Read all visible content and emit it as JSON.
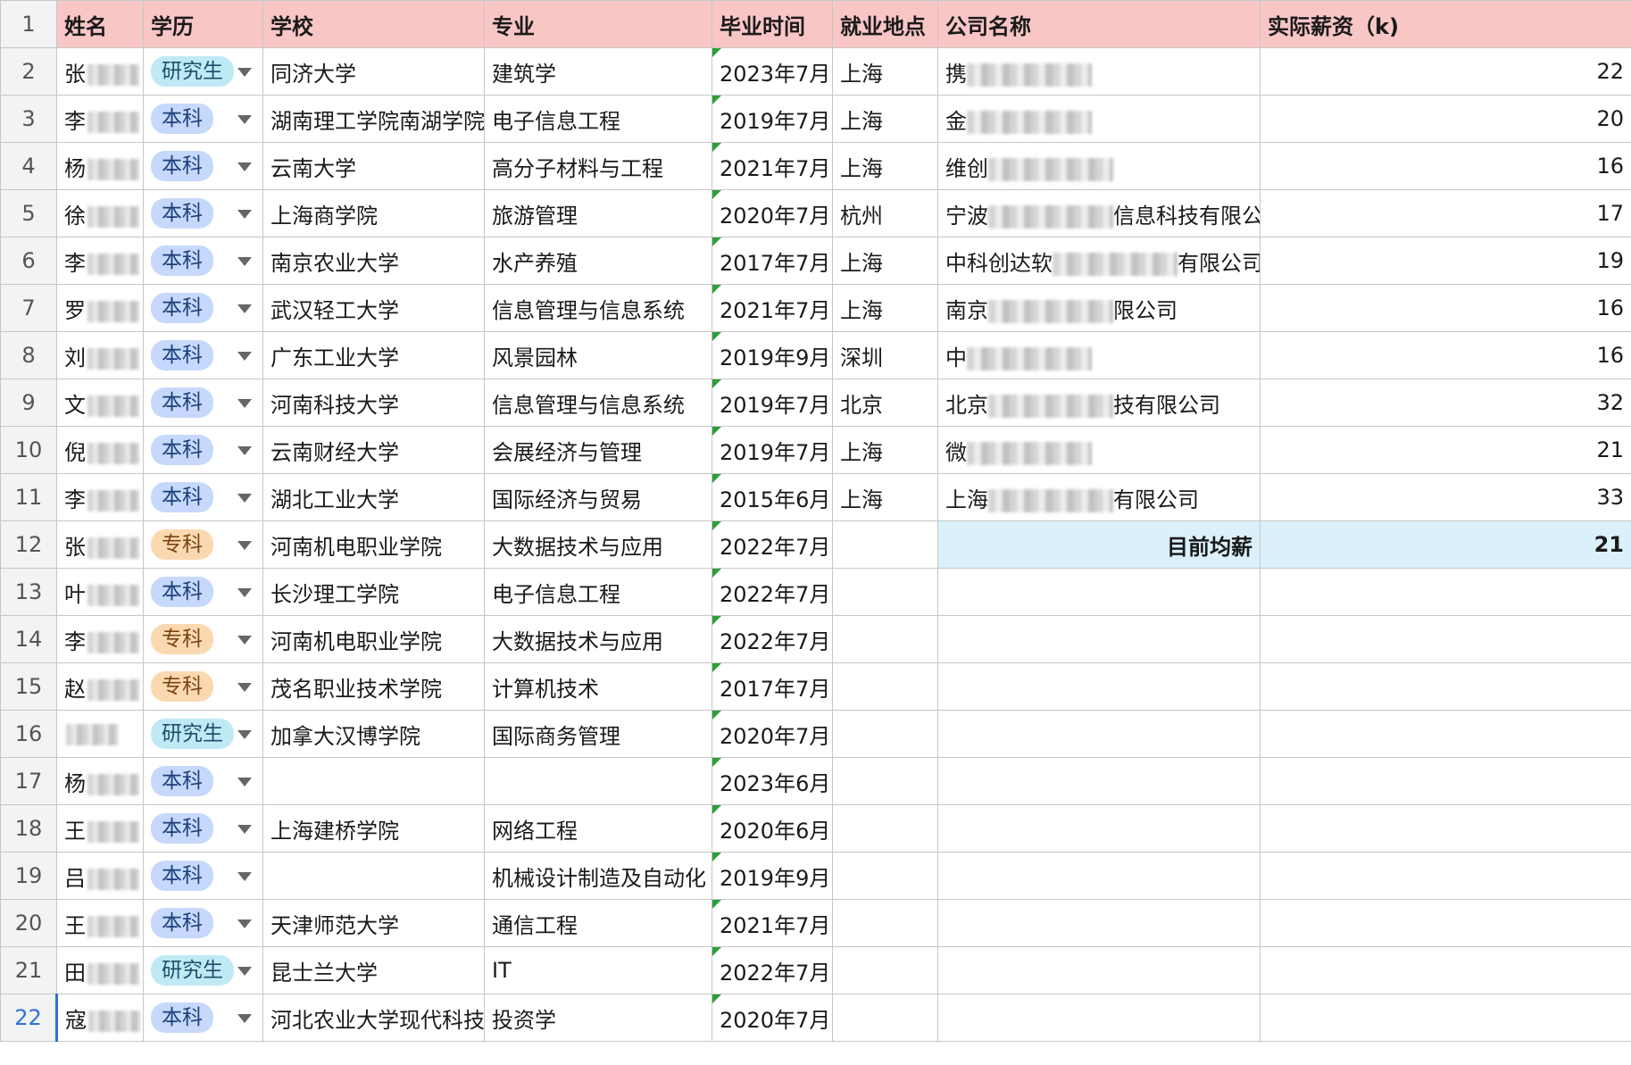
{
  "columns": [
    "姓名",
    "学历",
    "学校",
    "专业",
    "毕业时间",
    "就业地点",
    "公司名称",
    "实际薪资（k)"
  ],
  "header_row_number": "1",
  "rows": [
    {
      "num": "2",
      "name": "张",
      "edu": "研究生",
      "edu_type": "grad",
      "school": "同济大学",
      "major": "建筑学",
      "grad": "2023年7月",
      "loc": "上海",
      "company": "携",
      "salary": "22"
    },
    {
      "num": "3",
      "name": "李",
      "edu": "本科",
      "edu_type": "bach",
      "school": "湖南理工学院南湖学院",
      "major": "电子信息工程",
      "grad": "2019年7月",
      "loc": "上海",
      "company": "金",
      "salary": "20"
    },
    {
      "num": "4",
      "name": "杨",
      "edu": "本科",
      "edu_type": "bach",
      "school": "云南大学",
      "major": "高分子材料与工程",
      "grad": "2021年7月",
      "loc": "上海",
      "company": "维创",
      "salary": "16"
    },
    {
      "num": "5",
      "name": "徐",
      "edu": "本科",
      "edu_type": "bach",
      "school": "上海商学院",
      "major": "旅游管理",
      "grad": "2020年7月",
      "loc": "杭州",
      "company": "宁波",
      "company_suffix": "信息科技有限公司",
      "salary": "17"
    },
    {
      "num": "6",
      "name": "李",
      "edu": "本科",
      "edu_type": "bach",
      "school": "南京农业大学",
      "major": "水产养殖",
      "grad": "2017年7月",
      "loc": "上海",
      "company": "中科创达软",
      "company_suffix": "有限公司",
      "salary": "19"
    },
    {
      "num": "7",
      "name": "罗",
      "edu": "本科",
      "edu_type": "bach",
      "school": "武汉轻工大学",
      "major": "信息管理与信息系统",
      "grad": "2021年7月",
      "loc": "上海",
      "company": "南京",
      "company_suffix": "限公司",
      "salary": "16"
    },
    {
      "num": "8",
      "name": "刘",
      "edu": "本科",
      "edu_type": "bach",
      "school": "广东工业大学",
      "major": "风景园林",
      "grad": "2019年9月",
      "loc": "深圳",
      "company": "中",
      "salary": "16"
    },
    {
      "num": "9",
      "name": "文",
      "edu": "本科",
      "edu_type": "bach",
      "school": "河南科技大学",
      "major": "信息管理与信息系统",
      "grad": "2019年7月",
      "loc": "北京",
      "company": "北京",
      "company_suffix": "技有限公司",
      "salary": "32"
    },
    {
      "num": "10",
      "name": "倪",
      "edu": "本科",
      "edu_type": "bach",
      "school": "云南财经大学",
      "major": "会展经济与管理",
      "grad": "2019年7月",
      "loc": "上海",
      "company": "微",
      "salary": "21"
    },
    {
      "num": "11",
      "name": "李",
      "edu": "本科",
      "edu_type": "bach",
      "school": "湖北工业大学",
      "major": "国际经济与贸易",
      "grad": "2015年6月",
      "loc": "上海",
      "company": "上海",
      "company_suffix": "有限公司",
      "salary": "33"
    },
    {
      "num": "12",
      "name": "张",
      "edu": "专科",
      "edu_type": "assoc",
      "school": "河南机电职业学院",
      "major": "大数据技术与应用",
      "grad": "2022年7月",
      "loc": "",
      "company": "",
      "salary": ""
    },
    {
      "num": "13",
      "name": "叶",
      "edu": "本科",
      "edu_type": "bach",
      "school": "长沙理工学院",
      "major": "电子信息工程",
      "grad": "2022年7月",
      "loc": "",
      "company": "",
      "salary": ""
    },
    {
      "num": "14",
      "name": "李",
      "edu": "专科",
      "edu_type": "assoc",
      "school": "河南机电职业学院",
      "major": "大数据技术与应用",
      "grad": "2022年7月",
      "loc": "",
      "company": "",
      "salary": ""
    },
    {
      "num": "15",
      "name": "赵",
      "edu": "专科",
      "edu_type": "assoc",
      "school": "茂名职业技术学院",
      "major": "计算机技术",
      "grad": "2017年7月",
      "loc": "",
      "company": "",
      "salary": ""
    },
    {
      "num": "16",
      "name": "",
      "edu": "研究生",
      "edu_type": "grad",
      "school": "加拿大汉博学院",
      "major": "国际商务管理",
      "grad": "2020年7月",
      "loc": "",
      "company": "",
      "salary": ""
    },
    {
      "num": "17",
      "name": "杨",
      "edu": "本科",
      "edu_type": "bach",
      "school": "",
      "major": "",
      "grad": "2023年6月",
      "loc": "",
      "company": "",
      "salary": ""
    },
    {
      "num": "18",
      "name": "王",
      "edu": "本科",
      "edu_type": "bach",
      "school": "上海建桥学院",
      "major": "网络工程",
      "grad": "2020年6月",
      "loc": "",
      "company": "",
      "salary": ""
    },
    {
      "num": "19",
      "name": "吕",
      "edu": "本科",
      "edu_type": "bach",
      "school": "",
      "major": "机械设计制造及自动化",
      "grad": "2019年9月",
      "loc": "",
      "company": "",
      "salary": ""
    },
    {
      "num": "20",
      "name": "王",
      "edu": "本科",
      "edu_type": "bach",
      "school": "天津师范大学",
      "major": "通信工程",
      "grad": "2021年7月",
      "loc": "",
      "company": "",
      "salary": ""
    },
    {
      "num": "21",
      "name": "田",
      "edu": "研究生",
      "edu_type": "grad",
      "school": "昆士兰大学",
      "major": "IT",
      "grad": "2022年7月",
      "loc": "",
      "company": "",
      "salary": ""
    },
    {
      "num": "22",
      "name": "寇",
      "edu": "本科",
      "edu_type": "bach",
      "school": "河北农业大学现代科技学院",
      "major": "投资学",
      "grad": "2020年7月",
      "loc": "",
      "company": "",
      "salary": ""
    }
  ],
  "summary": {
    "row_index": 10,
    "label": "目前均薪",
    "value": "21"
  },
  "active_row_num": "22",
  "colors": {
    "header_bg": "#f9c6c6",
    "summary_bg": "#daf0fb",
    "active_accent": "#2f6fd6"
  }
}
